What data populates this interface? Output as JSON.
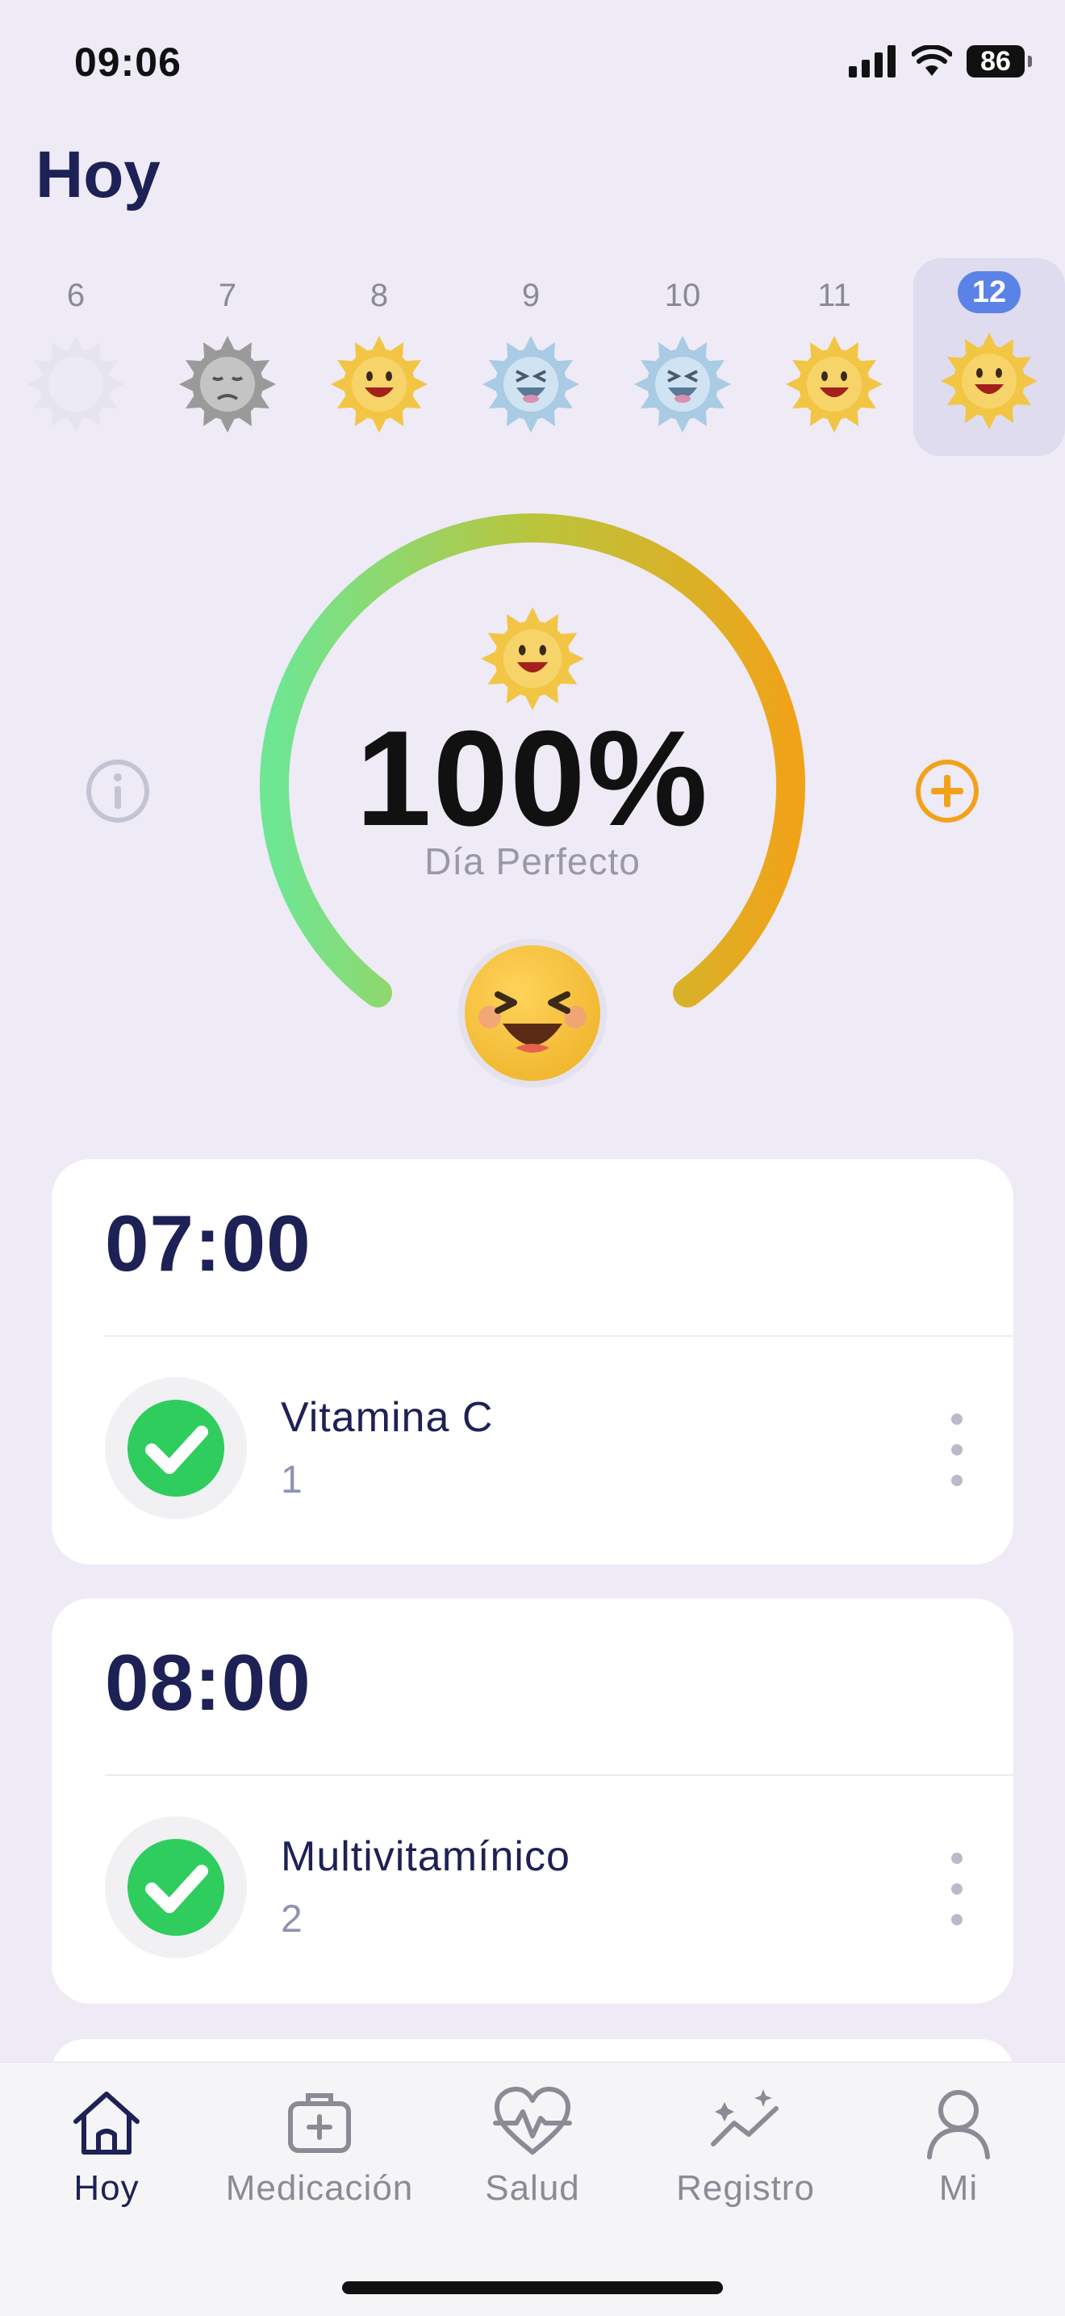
{
  "status_bar": {
    "time": "09:06",
    "battery": "86"
  },
  "header": {
    "title": "Hoy"
  },
  "week": [
    {
      "day": "6",
      "mood": "empty"
    },
    {
      "day": "7",
      "mood": "sad"
    },
    {
      "day": "8",
      "mood": "happy"
    },
    {
      "day": "9",
      "mood": "laughing"
    },
    {
      "day": "10",
      "mood": "laughing"
    },
    {
      "day": "11",
      "mood": "happy"
    },
    {
      "day": "12",
      "mood": "happy",
      "selected": true
    }
  ],
  "summary": {
    "percent": "100%",
    "label": "Día Perfecto",
    "progress": 1.0
  },
  "schedule": [
    {
      "time": "07:00",
      "medication": "Vitamina C",
      "quantity": "1",
      "taken": true
    },
    {
      "time": "08:00",
      "medication": "Multivitamínico",
      "quantity": "2",
      "taken": true
    }
  ],
  "tabs": [
    {
      "label": "Hoy",
      "icon": "home-icon",
      "active": true
    },
    {
      "label": "Medicación",
      "icon": "medicine-box-icon"
    },
    {
      "label": "Salud",
      "icon": "heartbeat-icon"
    },
    {
      "label": "Registro",
      "icon": "trend-icon"
    },
    {
      "label": "Mi",
      "icon": "person-icon"
    }
  ],
  "colors": {
    "background": "#eeeaf6",
    "accent_blue": "#5b82e6",
    "title_navy": "#1e2156",
    "check_green": "#2fcc5e",
    "add_orange": "#f2a21a"
  }
}
